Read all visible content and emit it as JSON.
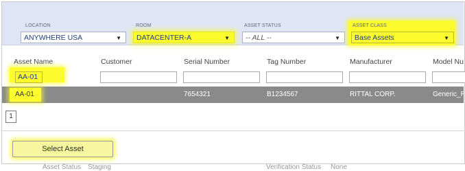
{
  "filters": {
    "location": {
      "label": "LOCATION",
      "value": "ANYWHERE USA"
    },
    "room": {
      "label": "ROOM",
      "value": "DATACENTER-A"
    },
    "asset_status": {
      "label": "ASSET STATUS",
      "value": "-- ALL --"
    },
    "asset_class": {
      "label": "ASSET CLASS",
      "value": "Base Assets"
    }
  },
  "columns": [
    "Asset Name",
    "Customer",
    "Serial Number",
    "Tag Number",
    "Manufacturer",
    "Model Nu"
  ],
  "column_filters": {
    "asset_name": "AA-01"
  },
  "rows": [
    {
      "asset_name": "AA-01",
      "customer": "",
      "serial_number": "7654321",
      "tag_number": "B1234567",
      "manufacturer": "RITTAL CORP.",
      "model": "Generic_R"
    }
  ],
  "pager": {
    "current_page": "1"
  },
  "select_button": "Select Asset",
  "background_form": {
    "asset_status_label": "Asset Status",
    "asset_status_value": "Staging",
    "verification_status_label": "Verification Status",
    "verification_status_value": "None"
  },
  "colors": {
    "highlight": "#fbfb2e",
    "filter_bar": "#dfe5f4",
    "selected_row": "#8a8a8a"
  }
}
